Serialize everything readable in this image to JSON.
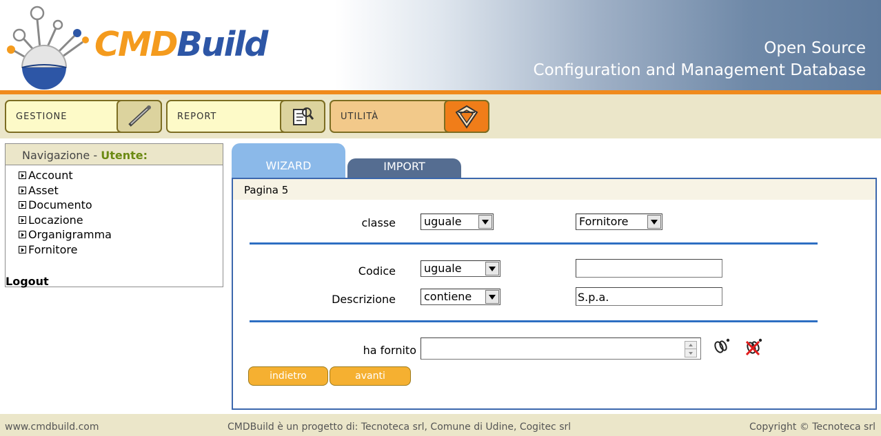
{
  "header": {
    "logo_cmd": "CMD",
    "logo_build": "Build",
    "tagline_line1": "Open Source",
    "tagline_line2": "Configuration and Management Database"
  },
  "menu": {
    "gestione_label": "GESTIONE",
    "report_label": "REPORT",
    "utilita_label": "UTILITÀ"
  },
  "sidebar": {
    "title_prefix": "Navigazione - ",
    "title_user": "Utente:",
    "items": [
      {
        "label": "Account"
      },
      {
        "label": "Asset"
      },
      {
        "label": "Documento"
      },
      {
        "label": "Locazione"
      },
      {
        "label": "Organigramma"
      },
      {
        "label": "Fornitore"
      }
    ],
    "logout_label": "Logout"
  },
  "tabs": {
    "wizard_label": "WIZARD",
    "import_label": "IMPORT"
  },
  "page": {
    "title": "Pagina 5",
    "classe_label": "classe",
    "classe_operator": "uguale",
    "classe_value": "Fornitore",
    "codice_label": "Codice",
    "codice_operator": "uguale",
    "codice_value": "",
    "descrizione_label": "Descrizione",
    "descrizione_operator": "contiene",
    "descrizione_value": "S.p.a.",
    "ha_fornito_label": "ha fornito",
    "ha_fornito_value": "",
    "back_button": "indietro",
    "next_button": "avanti"
  },
  "footer": {
    "site": "www.cmdbuild.com",
    "credits": "CMDBuild è un progetto di: Tecnoteca srl, Comune di Udine, Cogitec srl",
    "copyright": "Copyright © Tecnoteca srl"
  },
  "colors": {
    "accent_orange": "#f08a1c",
    "brand_blue": "#2d56a6",
    "tab_blue": "#8bb9e9",
    "tab_dark": "#556d91",
    "button_orange": "#f5b031"
  }
}
